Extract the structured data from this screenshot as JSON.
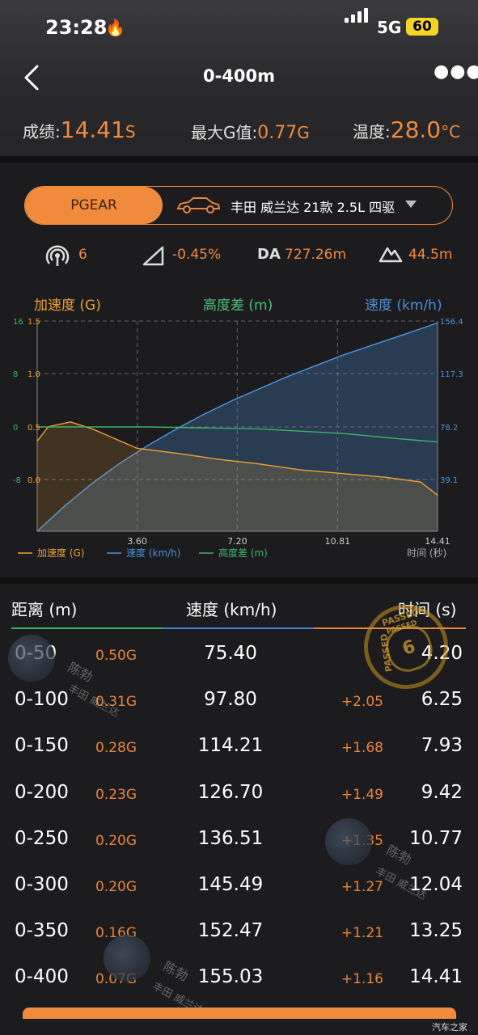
{
  "status": {
    "time": "23:28",
    "network": "5G",
    "battery": "60"
  },
  "nav": {
    "title": "0-400m"
  },
  "stats": [
    {
      "label": "成绩:",
      "value": "14.41",
      "unit": "S"
    },
    {
      "label": "最大G值:",
      "value": "0.77",
      "unit": "G"
    },
    {
      "label": "温度:",
      "value": "28.0",
      "unit": "°C"
    }
  ],
  "selector": {
    "pgear": "PGEAR",
    "car": "丰田 威兰达 21款 2.5L 四驱"
  },
  "chips": {
    "satellites": "6",
    "slope": "-0.45%",
    "da_label": "DA",
    "da": "727.26m",
    "elevation": "44.5m"
  },
  "chart_labels": {
    "accel": "加速度 (G)",
    "alt": "高度差 (m)",
    "speed": "速度 (km/h)"
  },
  "chart_data": {
    "type": "line",
    "x_ticks": [
      "3.60",
      "7.20",
      "10.81",
      "14.41"
    ],
    "xlabel": "时间 (秒)",
    "left_alt_ticks": [
      "16",
      "8",
      "0",
      "-8"
    ],
    "left_accel_ticks": [
      "1.5",
      "1.0",
      "0.5",
      "0.0"
    ],
    "right_speed_ticks": [
      "156.4",
      "117.3",
      "78.2",
      "39.1"
    ],
    "xlim": [
      0,
      14.41
    ],
    "series": [
      {
        "name": "速度 (km/h)",
        "x": [
          0,
          1,
          2,
          3,
          4,
          5,
          6,
          7,
          8,
          9,
          10,
          11,
          12,
          13,
          14,
          14.41
        ],
        "values": [
          0,
          19,
          36,
          51,
          64,
          76,
          87,
          97,
          106,
          115,
          123,
          131,
          138,
          145,
          152,
          155.03
        ]
      },
      {
        "name": "高度差 (m)",
        "x": [
          0,
          4,
          8,
          11,
          13,
          14.41
        ],
        "values": [
          0,
          0,
          -0.3,
          -1,
          -1.8,
          -2.3
        ]
      },
      {
        "name": "加速度 (G)",
        "x": [
          0,
          0.4,
          1.2,
          2,
          2.8,
          3.6,
          5,
          6.5,
          8,
          9.5,
          11,
          12.5,
          13.8,
          14.41
        ],
        "values": [
          0.5,
          0.62,
          0.66,
          0.6,
          0.52,
          0.44,
          0.4,
          0.35,
          0.31,
          0.26,
          0.23,
          0.2,
          0.16,
          0.05
        ]
      }
    ]
  },
  "table": {
    "headers": {
      "distance": "距离 (m)",
      "speed": "速度 (km/h)",
      "time": "时间 (s)"
    },
    "rows": [
      {
        "d": "0-50",
        "g": "0.50G",
        "s": "75.40",
        "dl": "",
        "t": "4.20"
      },
      {
        "d": "0-100",
        "g": "0.31G",
        "s": "97.80",
        "dl": "+2.05",
        "t": "6.25"
      },
      {
        "d": "0-150",
        "g": "0.28G",
        "s": "114.21",
        "dl": "+1.68",
        "t": "7.93"
      },
      {
        "d": "0-200",
        "g": "0.23G",
        "s": "126.70",
        "dl": "+1.49",
        "t": "9.42"
      },
      {
        "d": "0-250",
        "g": "0.20G",
        "s": "136.51",
        "dl": "+1.35",
        "t": "10.77"
      },
      {
        "d": "0-300",
        "g": "0.20G",
        "s": "145.49",
        "dl": "+1.27",
        "t": "12.04"
      },
      {
        "d": "0-350",
        "g": "0.16G",
        "s": "152.47",
        "dl": "+1.21",
        "t": "13.25"
      },
      {
        "d": "0-400",
        "g": "0.07G",
        "s": "155.03",
        "dl": "+1.16",
        "t": "14.41"
      }
    ]
  },
  "stamp": {
    "top": "PASSED",
    "left": "PASSED",
    "middle": "PASSED",
    "num": "6"
  },
  "watermarks": {
    "name": "陈勃",
    "car": "丰田 威兰达"
  },
  "corner": "汽车之家"
}
